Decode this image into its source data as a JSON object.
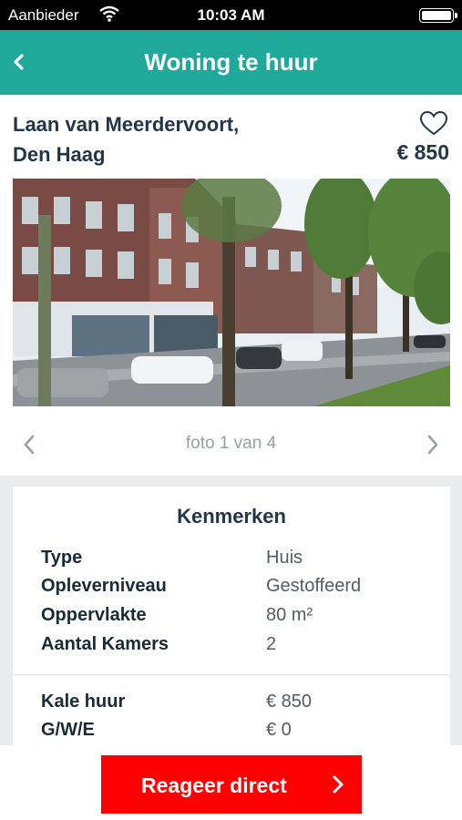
{
  "status_bar": {
    "carrier": "Aanbieder",
    "time": "10:03 AM",
    "wifi_icon": "wifi-icon",
    "battery_icon": "battery-icon"
  },
  "nav": {
    "title": "Woning te huur",
    "back_icon": "chevron-left-icon"
  },
  "listing": {
    "address_line1": "Laan van Meerdervoort,",
    "address_line2": "Den Haag",
    "price": "€ 850",
    "favorite_icon": "heart-outline-icon",
    "photo_pager": "foto 1 van 4"
  },
  "features": {
    "title": "Kenmerken",
    "rows": [
      {
        "label": "Type",
        "value": "Huis"
      },
      {
        "label": "Opleverniveau",
        "value": "Gestoffeerd"
      },
      {
        "label": "Oppervlakte",
        "value": "80 m²"
      },
      {
        "label": "Aantal Kamers",
        "value": "2"
      }
    ],
    "cost_rows": [
      {
        "label": "Kale huur",
        "value": "€ 850"
      },
      {
        "label": "G/W/E",
        "value": "€ 0"
      }
    ]
  },
  "cta": {
    "label": "Reageer direct"
  },
  "colors": {
    "accent": "#1ea99b",
    "cta": "#ff0000",
    "text_dark": "#22364a"
  }
}
